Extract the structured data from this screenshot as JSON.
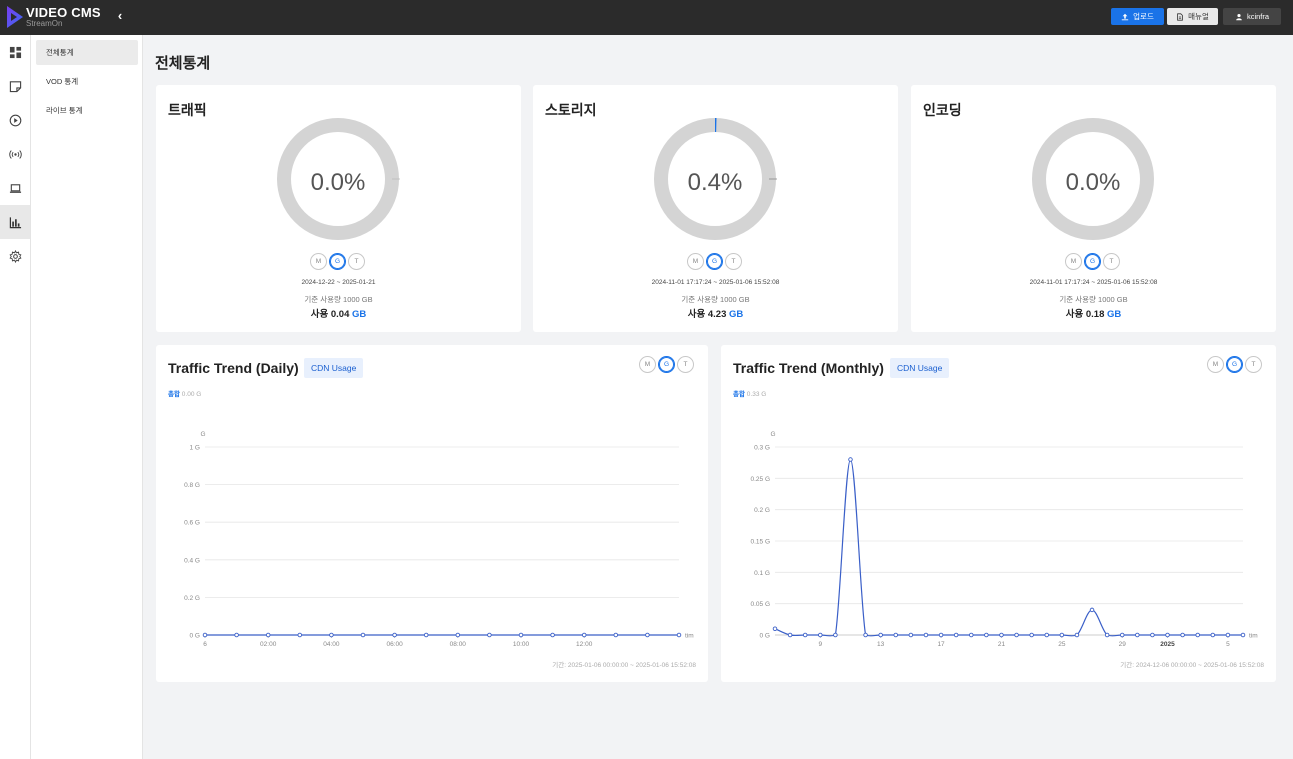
{
  "topbar": {
    "brand": "VIDEO CMS",
    "brand_sub": "StreamOn",
    "collapse_icon": "chevron-left-icon",
    "upload_label": "업로드",
    "manual_label": "매뉴얼",
    "user_label": "kcinfra",
    "accent": "#1a73e8"
  },
  "rail": {
    "items": [
      {
        "icon": "dashboard-icon"
      },
      {
        "icon": "note-icon"
      },
      {
        "icon": "play-circle-icon"
      },
      {
        "icon": "broadcast-icon"
      },
      {
        "icon": "laptop-icon"
      },
      {
        "icon": "bar-chart-icon",
        "active": true
      },
      {
        "icon": "gear-icon"
      }
    ]
  },
  "subnav": {
    "items": [
      {
        "label": "전체통계",
        "active": true
      },
      {
        "label": "VOD 통계"
      },
      {
        "label": "라이브 통계"
      }
    ]
  },
  "page_title": "전체통계",
  "cards": [
    {
      "title": "트래픽",
      "percent_label": "0.0%",
      "percent": 0.0,
      "period": "2024-12-22 ~ 2025-01-21",
      "basis": "기준 사용량 1000 GB",
      "usage_prefix": "사용 0.04",
      "usage_unit": "GB",
      "toggle": [
        "M",
        "G",
        "T"
      ],
      "toggle_selected": "G"
    },
    {
      "title": "스토리지",
      "percent_label": "0.4%",
      "percent": 0.4,
      "period": "2024-11-01 17:17:24 ~ 2025-01-06 15:52:08",
      "basis": "기준 사용량 1000 GB",
      "usage_prefix": "사용 4.23",
      "usage_unit": "GB",
      "toggle": [
        "M",
        "G",
        "T"
      ],
      "toggle_selected": "G"
    },
    {
      "title": "인코딩",
      "percent_label": "0.0%",
      "percent": 0.0,
      "period": "2024-11-01 17:17:24 ~ 2025-01-06 15:52:08",
      "basis": "기준 사용량 1000 GB",
      "usage_prefix": "사용 0.18",
      "usage_unit": "GB",
      "toggle": [
        "M",
        "G",
        "T"
      ],
      "toggle_selected": "G"
    }
  ],
  "trends": [
    {
      "title": "Traffic Trend (Daily)",
      "badge": "CDN Usage",
      "total_label": "총합",
      "total_value": "0.00 G",
      "range": "기간: 2025-01-06 00:00:00 ~ 2025-01-06 15:52:08",
      "toggle": [
        "M",
        "G",
        "T"
      ],
      "toggle_selected": "G"
    },
    {
      "title": "Traffic Trend (Monthly)",
      "badge": "CDN Usage",
      "total_label": "총합",
      "total_value": "0.33 G",
      "range": "기간: 2024-12-06 00:00:00 ~ 2025-01-06 15:52:08",
      "toggle": [
        "M",
        "G",
        "T"
      ],
      "toggle_selected": "G"
    }
  ],
  "chart_data": [
    {
      "type": "line",
      "title": "Traffic Trend (Daily)",
      "ylabel": "G",
      "xlabel": "tim",
      "ylim": [
        0,
        1
      ],
      "y_ticks": [
        "0 G",
        "0.2 G",
        "0.4 G",
        "0.6 G",
        "0.8 G",
        "1 G"
      ],
      "x_ticks": [
        "6",
        "02:00",
        "04:00",
        "06:00",
        "08:00",
        "10:00",
        "12:00"
      ],
      "x": [
        0,
        1,
        2,
        3,
        4,
        5,
        6,
        7,
        8,
        9,
        10,
        11,
        12,
        13,
        14,
        15
      ],
      "series": [
        {
          "values": [
            0,
            0,
            0,
            0,
            0,
            0,
            0,
            0,
            0,
            0,
            0,
            0,
            0,
            0,
            0,
            0
          ]
        }
      ],
      "color": "#3a5fc8",
      "grid": true
    },
    {
      "type": "line",
      "title": "Traffic Trend (Monthly)",
      "ylabel": "G",
      "xlabel": "tim",
      "ylim": [
        0,
        0.3
      ],
      "y_ticks": [
        "0 G",
        "0.05 G",
        "0.1 G",
        "0.15 G",
        "0.2 G",
        "0.25 G",
        "0.3 G"
      ],
      "x_ticks": [
        "9",
        "13",
        "17",
        "21",
        "25",
        "29",
        "2025",
        "5"
      ],
      "x": [
        "2024-12-06",
        "2024-12-07",
        "2024-12-08",
        "2024-12-09",
        "2024-12-10",
        "2024-12-11",
        "2024-12-12",
        "2024-12-13",
        "2024-12-14",
        "2024-12-15",
        "2024-12-16",
        "2024-12-17",
        "2024-12-18",
        "2024-12-19",
        "2024-12-20",
        "2024-12-21",
        "2024-12-22",
        "2024-12-23",
        "2024-12-24",
        "2024-12-25",
        "2024-12-26",
        "2024-12-27",
        "2024-12-28",
        "2024-12-29",
        "2024-12-30",
        "2024-12-31",
        "2025-01-01",
        "2025-01-02",
        "2025-01-03",
        "2025-01-04",
        "2025-01-05",
        "2025-01-06"
      ],
      "series": [
        {
          "values": [
            0.01,
            0,
            0,
            0,
            0,
            0.28,
            0,
            0,
            0,
            0,
            0,
            0,
            0,
            0,
            0,
            0,
            0,
            0,
            0,
            0,
            0,
            0.04,
            0,
            0,
            0,
            0,
            0,
            0,
            0,
            0,
            0,
            0
          ]
        }
      ],
      "color": "#3a5fc8",
      "grid": true
    }
  ]
}
